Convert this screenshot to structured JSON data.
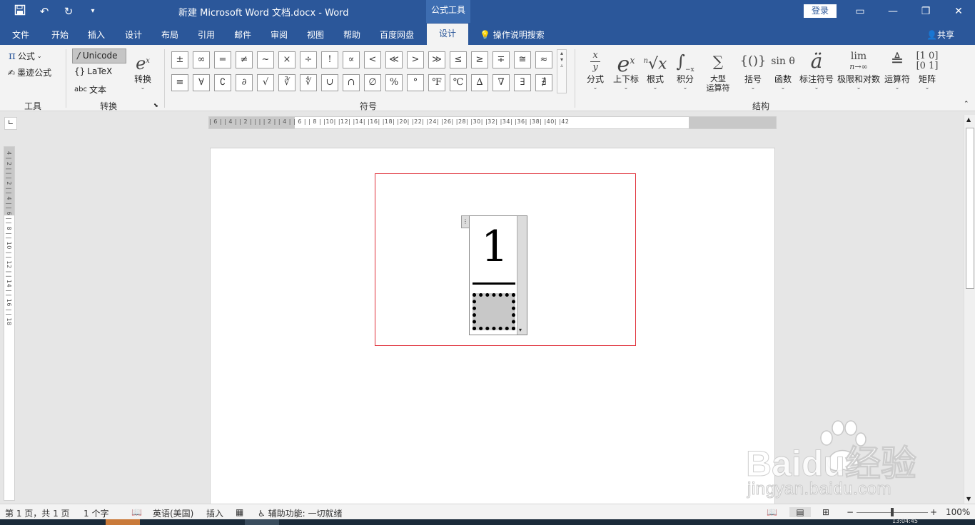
{
  "titlebar": {
    "doc_title": "新建 Microsoft Word 文档.docx  -  Word",
    "context_tab": "公式工具",
    "login": "登录",
    "colors": {
      "accent": "#2b579a",
      "selection_border": "#e0303a"
    }
  },
  "tabs": {
    "items": [
      "文件",
      "开始",
      "插入",
      "设计",
      "布局",
      "引用",
      "邮件",
      "审阅",
      "视图",
      "帮助",
      "百度网盘"
    ],
    "active": "设计",
    "search": "操作说明搜索",
    "share": "共享"
  },
  "ribbon": {
    "tools": {
      "formula": "公式",
      "ink": "墨迹公式",
      "group": "工具"
    },
    "convert": {
      "unicode": "Unicode",
      "latex": "LaTeX",
      "text": "文本",
      "convert_btn": "转换",
      "group": "转换"
    },
    "symbols": {
      "group": "符号",
      "items": [
        "±",
        "∞",
        "=",
        "≠",
        "~",
        "×",
        "÷",
        "!",
        "∝",
        "<",
        "≪",
        ">",
        "≫",
        "≤",
        "≥",
        "∓",
        "≅",
        "≈",
        "≡",
        "∀",
        "∁",
        "∂",
        "√",
        "∛",
        "∜",
        "∪",
        "∩",
        "∅",
        "%",
        "°",
        "℉",
        "℃",
        "∆",
        "∇",
        "∃",
        "∄"
      ]
    },
    "structures": {
      "group": "结构",
      "items": [
        {
          "label": "分式",
          "icon": "fraction-icon"
        },
        {
          "label": "上下标",
          "icon": "script-icon"
        },
        {
          "label": "根式",
          "icon": "radical-icon"
        },
        {
          "label": "积分",
          "icon": "integral-icon"
        },
        {
          "label": "大型\n运算符",
          "icon": "large-operator-icon"
        },
        {
          "label": "括号",
          "icon": "bracket-icon"
        },
        {
          "label": "函数",
          "icon": "function-icon"
        },
        {
          "label": "标注符号",
          "icon": "accent-icon"
        },
        {
          "label": "极限和对数",
          "icon": "limit-icon"
        },
        {
          "label": "运算符",
          "icon": "operator-icon"
        },
        {
          "label": "矩阵",
          "icon": "matrix-icon"
        }
      ]
    }
  },
  "rulers": {
    "horizontal": "| 6 | | 4 | | 2 | | | | 2 | | 4 | | 6 | | 8 | |10| |12| |14| |16| |18| |20| |22| |24| |26| |28| |30| |32| |34| |36| |38| |40| |42",
    "vertical": "4 | 2 | | | 2 | | 4 | | 6 | | 8 | | 10 | | 12 | | 14 | | 16 | | 18"
  },
  "equation": {
    "numerator": "1"
  },
  "status": {
    "page": "第 1 页，共 1 页",
    "words": "1 个字",
    "language": "英语(美国)",
    "mode": "插入",
    "accessibility": "辅助功能: 一切就绪",
    "zoom": "100%"
  },
  "taskbar": {
    "clock": "13:04:45"
  },
  "watermark": {
    "logo": "Baidu经验",
    "url": "jingyan.baidu.com"
  }
}
